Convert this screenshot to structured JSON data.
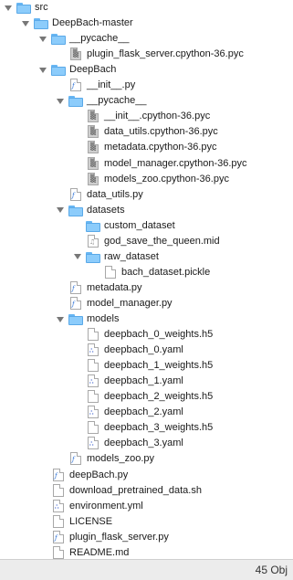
{
  "tree": [
    {
      "label": "src",
      "depth": 0,
      "kind": "folder",
      "expanded": true
    },
    {
      "label": "DeepBach-master",
      "depth": 1,
      "kind": "folder",
      "expanded": true
    },
    {
      "label": "__pycache__",
      "depth": 2,
      "kind": "folder",
      "expanded": true
    },
    {
      "label": "plugin_flask_server.cpython-36.pyc",
      "depth": 3,
      "kind": "pyc"
    },
    {
      "label": "DeepBach",
      "depth": 2,
      "kind": "folder",
      "expanded": true
    },
    {
      "label": "__init__.py",
      "depth": 3,
      "kind": "py"
    },
    {
      "label": "__pycache__",
      "depth": 3,
      "kind": "folder",
      "expanded": true
    },
    {
      "label": "__init__.cpython-36.pyc",
      "depth": 4,
      "kind": "pyc"
    },
    {
      "label": "data_utils.cpython-36.pyc",
      "depth": 4,
      "kind": "pyc"
    },
    {
      "label": "metadata.cpython-36.pyc",
      "depth": 4,
      "kind": "pyc"
    },
    {
      "label": "model_manager.cpython-36.pyc",
      "depth": 4,
      "kind": "pyc"
    },
    {
      "label": "models_zoo.cpython-36.pyc",
      "depth": 4,
      "kind": "pyc"
    },
    {
      "label": "data_utils.py",
      "depth": 3,
      "kind": "py"
    },
    {
      "label": "datasets",
      "depth": 3,
      "kind": "folder",
      "expanded": true
    },
    {
      "label": "custom_dataset",
      "depth": 4,
      "kind": "folder",
      "expanded": false
    },
    {
      "label": "god_save_the_queen.mid",
      "depth": 4,
      "kind": "mid"
    },
    {
      "label": "raw_dataset",
      "depth": 4,
      "kind": "folder",
      "expanded": true
    },
    {
      "label": "bach_dataset.pickle",
      "depth": 5,
      "kind": "file"
    },
    {
      "label": "metadata.py",
      "depth": 3,
      "kind": "py"
    },
    {
      "label": "model_manager.py",
      "depth": 3,
      "kind": "py"
    },
    {
      "label": "models",
      "depth": 3,
      "kind": "folder",
      "expanded": true
    },
    {
      "label": "deepbach_0_weights.h5",
      "depth": 4,
      "kind": "file"
    },
    {
      "label": "deepbach_0.yaml",
      "depth": 4,
      "kind": "yaml"
    },
    {
      "label": "deepbach_1_weights.h5",
      "depth": 4,
      "kind": "file"
    },
    {
      "label": "deepbach_1.yaml",
      "depth": 4,
      "kind": "yaml"
    },
    {
      "label": "deepbach_2_weights.h5",
      "depth": 4,
      "kind": "file"
    },
    {
      "label": "deepbach_2.yaml",
      "depth": 4,
      "kind": "yaml"
    },
    {
      "label": "deepbach_3_weights.h5",
      "depth": 4,
      "kind": "file"
    },
    {
      "label": "deepbach_3.yaml",
      "depth": 4,
      "kind": "yaml"
    },
    {
      "label": "models_zoo.py",
      "depth": 3,
      "kind": "py"
    },
    {
      "label": "deepBach.py",
      "depth": 2,
      "kind": "py"
    },
    {
      "label": "download_pretrained_data.sh",
      "depth": 2,
      "kind": "file"
    },
    {
      "label": "environment.yml",
      "depth": 2,
      "kind": "yaml"
    },
    {
      "label": "LICENSE",
      "depth": 2,
      "kind": "file"
    },
    {
      "label": "plugin_flask_server.py",
      "depth": 2,
      "kind": "py"
    },
    {
      "label": "README.md",
      "depth": 2,
      "kind": "file"
    }
  ],
  "status": {
    "text": "45 Obj"
  }
}
